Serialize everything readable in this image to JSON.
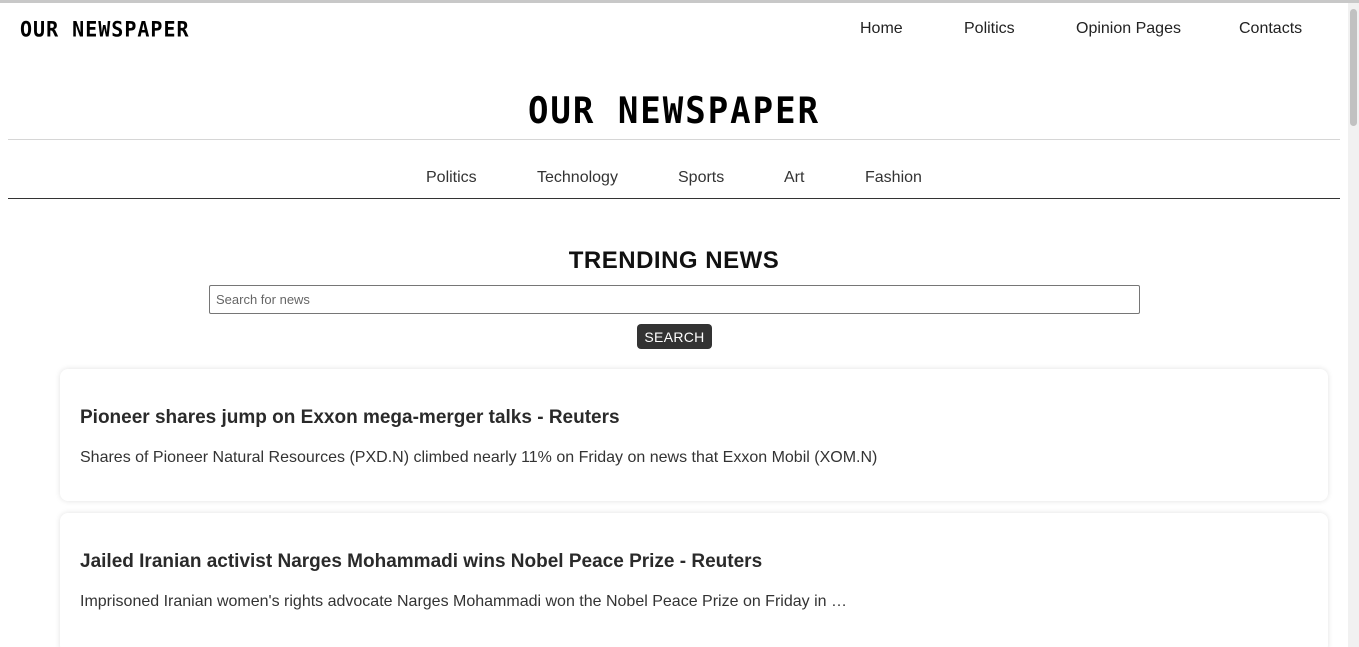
{
  "site": {
    "logo_text": "OUR NEWSPAPER",
    "masthead_text": "OUR NEWSPAPER"
  },
  "topnav": {
    "items": [
      {
        "label": "Home"
      },
      {
        "label": "Politics"
      },
      {
        "label": "Opinion Pages"
      },
      {
        "label": "Contacts"
      }
    ]
  },
  "categories": {
    "items": [
      {
        "label": "Politics"
      },
      {
        "label": "Technology"
      },
      {
        "label": "Sports"
      },
      {
        "label": "Art"
      },
      {
        "label": "Fashion"
      }
    ]
  },
  "trending": {
    "title": "TRENDING NEWS",
    "search_placeholder": "Search for news",
    "search_value": "",
    "search_button_label": "SEARCH"
  },
  "articles": [
    {
      "title": "Pioneer shares jump on Exxon mega-merger talks - Reuters",
      "description": "Shares of Pioneer Natural Resources (PXD.N) climbed nearly 11% on Friday on news that Exxon Mobil (XOM.N)"
    },
    {
      "title": "Jailed Iranian activist Narges Mohammadi wins Nobel Peace Prize - Reuters",
      "description": "Imprisoned Iranian women's rights advocate Narges Mohammadi won the Nobel Peace Prize on Friday in …"
    }
  ],
  "colors": {
    "text": "#222222",
    "button_bg": "#333333",
    "button_text": "#ffffff",
    "rule_dark": "#333333",
    "rule_light": "#d6d6d6"
  }
}
